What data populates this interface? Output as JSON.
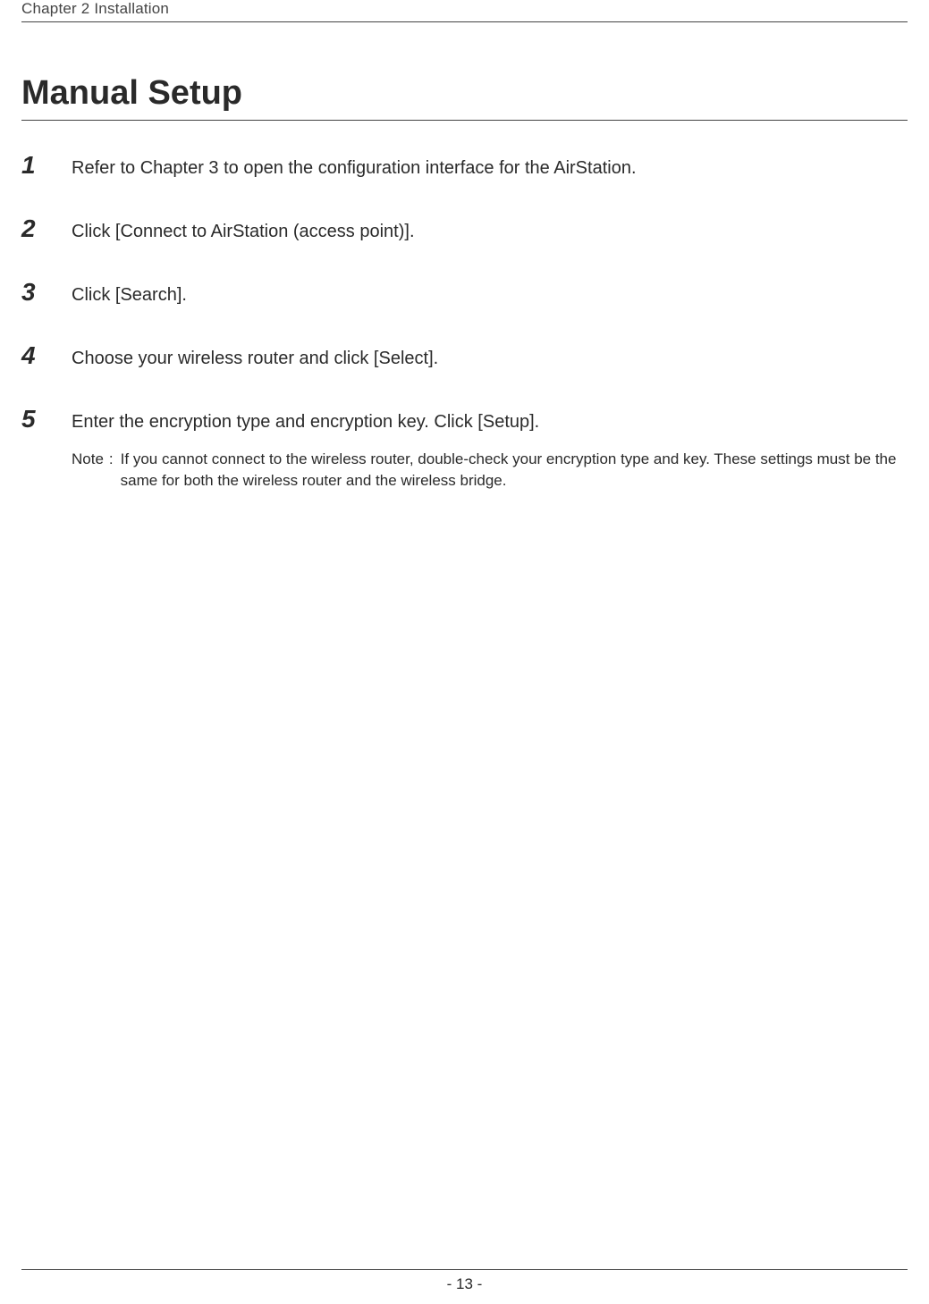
{
  "header": {
    "chapter": "Chapter 2  Installation"
  },
  "section": {
    "title": "Manual Setup"
  },
  "steps": [
    {
      "num": "1",
      "text": "Refer to Chapter 3 to open the configuration interface for the AirStation."
    },
    {
      "num": "2",
      "text": "Click [Connect to AirStation (access point)]."
    },
    {
      "num": "3",
      "text": "Click [Search]."
    },
    {
      "num": "4",
      "text": "Choose your wireless router and click [Select]."
    },
    {
      "num": "5",
      "text": "Enter the encryption type and encryption key. Click [Setup]."
    }
  ],
  "note": {
    "label": "Note",
    "colon": ":",
    "text": "If you cannot connect to the wireless router, double-check your encryption type and key.  These settings must be the same for both the wireless router and the wireless bridge."
  },
  "footer": {
    "page": "- 13 -"
  }
}
